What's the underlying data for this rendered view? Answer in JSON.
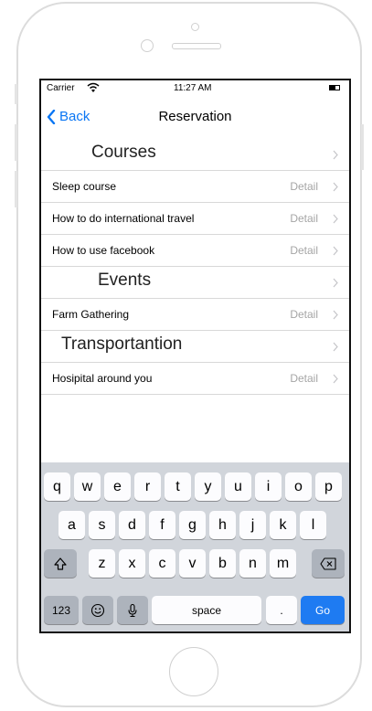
{
  "status": {
    "carrier": "Carrier",
    "time": "11:27 AM"
  },
  "nav": {
    "back_label": "Back",
    "title": "Reservation"
  },
  "sections": [
    {
      "title": "Courses",
      "items": [
        {
          "label": "Sleep course",
          "detail": "Detail"
        },
        {
          "label": "How to do international travel",
          "detail": "Detail"
        },
        {
          "label": "How to use facebook",
          "detail": "Detail"
        }
      ]
    },
    {
      "title": "Events",
      "items": [
        {
          "label": "Farm Gathering",
          "detail": "Detail"
        }
      ]
    },
    {
      "title": "Transportantion",
      "items": [
        {
          "label": "Hosipital around you",
          "detail": "Detail"
        }
      ]
    }
  ],
  "keyboard": {
    "row1": [
      "q",
      "w",
      "e",
      "r",
      "t",
      "y",
      "u",
      "i",
      "o",
      "p"
    ],
    "row2": [
      "a",
      "s",
      "d",
      "f",
      "g",
      "h",
      "j",
      "k",
      "l"
    ],
    "row3": [
      "z",
      "x",
      "c",
      "v",
      "b",
      "n",
      "m"
    ],
    "numbers_label": "123",
    "space_label": "space",
    "period_label": ".",
    "go_label": "Go"
  },
  "colors": {
    "accent": "#0a76f4",
    "go_key": "#1e7bf2",
    "keyboard_bg": "#d1d5db"
  }
}
